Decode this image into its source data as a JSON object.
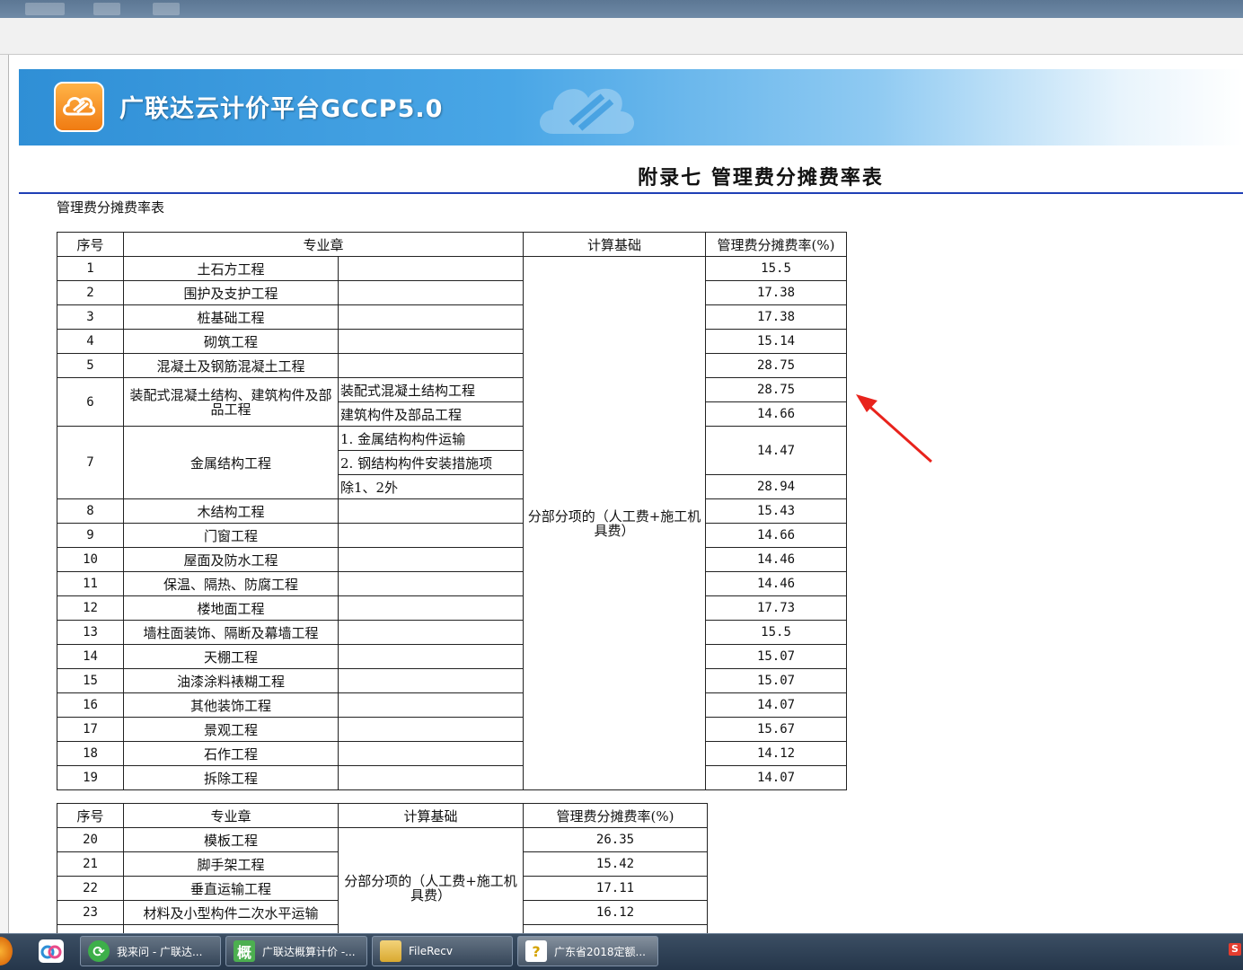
{
  "banner": {
    "title": "广联达云计价平台GCCP5.0"
  },
  "document": {
    "heading": "附录七  管理费分摊费率表",
    "caption": "管理费分摊费率表"
  },
  "table1": {
    "headers": [
      "序号",
      "专业章",
      "计算基础",
      "管理费分摊费率(%)"
    ],
    "basis": "分部分项的（人工费+施工机具费）",
    "rows": [
      {
        "no": "1",
        "name": "土石方工程",
        "rate": "15.5"
      },
      {
        "no": "2",
        "name": "围护及支护工程",
        "rate": "17.38"
      },
      {
        "no": "3",
        "name": "桩基础工程",
        "rate": "17.38"
      },
      {
        "no": "4",
        "name": "砌筑工程",
        "rate": "15.14"
      },
      {
        "no": "5",
        "name": "混凝土及钢筋混凝土工程",
        "rate": "28.75"
      },
      {
        "no": "6",
        "name": "装配式混凝土结构、建筑构件及部品工程",
        "sub1": "装配式混凝土结构工程",
        "rate1": "28.75",
        "sub2": "建筑构件及部品工程",
        "rate2": "14.66"
      },
      {
        "no": "7",
        "name": "金属结构工程",
        "sub1": "1. 金属结构构件运输",
        "sub2": "2. 钢结构构件安装措施项",
        "rate12": "14.47",
        "sub3": "除1、2外",
        "rate3": "28.94"
      },
      {
        "no": "8",
        "name": "木结构工程",
        "rate": "15.43"
      },
      {
        "no": "9",
        "name": "门窗工程",
        "rate": "14.66"
      },
      {
        "no": "10",
        "name": "屋面及防水工程",
        "rate": "14.46"
      },
      {
        "no": "11",
        "name": "保温、隔热、防腐工程",
        "rate": "14.46"
      },
      {
        "no": "12",
        "name": "楼地面工程",
        "rate": "17.73"
      },
      {
        "no": "13",
        "name": "墙柱面装饰、隔断及幕墙工程",
        "rate": "15.5"
      },
      {
        "no": "14",
        "name": "天棚工程",
        "rate": "15.07"
      },
      {
        "no": "15",
        "name": "油漆涂料裱糊工程",
        "rate": "15.07"
      },
      {
        "no": "16",
        "name": "其他装饰工程",
        "rate": "14.07"
      },
      {
        "no": "17",
        "name": "景观工程",
        "rate": "15.67"
      },
      {
        "no": "18",
        "name": "石作工程",
        "rate": "14.12"
      },
      {
        "no": "19",
        "name": "拆除工程",
        "rate": "14.07"
      }
    ]
  },
  "table2": {
    "headers": [
      "序号",
      "专业章",
      "计算基础",
      "管理费分摊费率(%)"
    ],
    "basis": "分部分项的（人工费+施工机具费）",
    "rows": [
      {
        "no": "20",
        "name": "模板工程",
        "rate": "26.35"
      },
      {
        "no": "21",
        "name": "脚手架工程",
        "rate": "15.42"
      },
      {
        "no": "22",
        "name": "垂直运输工程",
        "rate": "17.11"
      },
      {
        "no": "23",
        "name": "材料及小型构件二次水平运输",
        "rate": "16.12"
      }
    ]
  },
  "taskbar": {
    "items": [
      {
        "label": "我来问 - 广联达...",
        "icon": "chat-icon"
      },
      {
        "label": "广联达概算计价 -...",
        "icon": "gai-icon",
        "glyph": "概"
      },
      {
        "label": "FileRecv",
        "icon": "folder-icon"
      },
      {
        "label": "广东省2018定额...",
        "icon": "help-doc-icon"
      }
    ],
    "tray_glyph": "S"
  },
  "colors": {
    "banner_blue": "#2f8fd6",
    "rule_blue": "#1f3fb5",
    "annotation_arrow": "#e8231c"
  }
}
